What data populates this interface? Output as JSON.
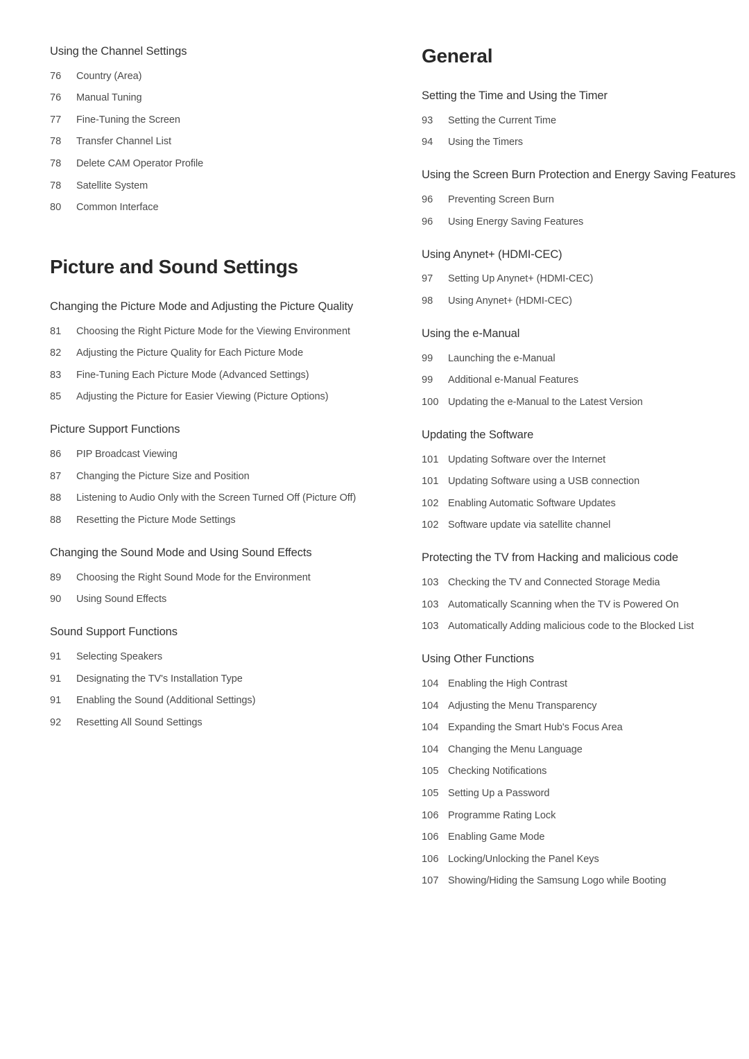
{
  "document": {
    "type": "table-of-contents",
    "columns": [
      {
        "id": "left",
        "blocks": [
          {
            "chapter_title": null,
            "sections": [
              {
                "heading": "Using the Channel Settings",
                "entries": [
                  {
                    "page": "76",
                    "title": "Country (Area)"
                  },
                  {
                    "page": "76",
                    "title": "Manual Tuning"
                  },
                  {
                    "page": "77",
                    "title": "Fine-Tuning the Screen"
                  },
                  {
                    "page": "78",
                    "title": "Transfer Channel List"
                  },
                  {
                    "page": "78",
                    "title": "Delete CAM Operator Profile"
                  },
                  {
                    "page": "78",
                    "title": "Satellite System"
                  },
                  {
                    "page": "80",
                    "title": "Common Interface"
                  }
                ]
              }
            ]
          },
          {
            "chapter_title": "Picture and Sound Settings",
            "sections": [
              {
                "heading": "Changing the Picture Mode and Adjusting the Picture Quality",
                "entries": [
                  {
                    "page": "81",
                    "title": "Choosing the Right Picture Mode for the Viewing Environment"
                  },
                  {
                    "page": "82",
                    "title": "Adjusting the Picture Quality for Each Picture Mode"
                  },
                  {
                    "page": "83",
                    "title": "Fine-Tuning Each Picture Mode (Advanced Settings)"
                  },
                  {
                    "page": "85",
                    "title": "Adjusting the Picture for Easier Viewing (Picture Options)"
                  }
                ]
              },
              {
                "heading": "Picture Support Functions",
                "entries": [
                  {
                    "page": "86",
                    "title": "PIP Broadcast Viewing"
                  },
                  {
                    "page": "87",
                    "title": "Changing the Picture Size and Position"
                  },
                  {
                    "page": "88",
                    "title": "Listening to Audio Only with the Screen Turned Off (Picture Off)"
                  },
                  {
                    "page": "88",
                    "title": "Resetting the Picture Mode Settings"
                  }
                ]
              },
              {
                "heading": "Changing the Sound Mode and Using Sound Effects",
                "entries": [
                  {
                    "page": "89",
                    "title": "Choosing the Right Sound Mode for the Environment"
                  },
                  {
                    "page": "90",
                    "title": "Using Sound Effects"
                  }
                ]
              },
              {
                "heading": "Sound Support Functions",
                "entries": [
                  {
                    "page": "91",
                    "title": "Selecting Speakers"
                  },
                  {
                    "page": "91",
                    "title": "Designating the TV's Installation Type"
                  },
                  {
                    "page": "91",
                    "title": "Enabling the Sound (Additional Settings)"
                  },
                  {
                    "page": "92",
                    "title": "Resetting All Sound Settings"
                  }
                ]
              }
            ]
          }
        ]
      },
      {
        "id": "right",
        "blocks": [
          {
            "chapter_title": "General",
            "sections": [
              {
                "heading": "Setting the Time and Using the Timer",
                "entries": [
                  {
                    "page": "93",
                    "title": "Setting the Current Time"
                  },
                  {
                    "page": "94",
                    "title": "Using the Timers"
                  }
                ]
              },
              {
                "heading": "Using the Screen Burn Protection and Energy Saving Features",
                "entries": [
                  {
                    "page": "96",
                    "title": "Preventing Screen Burn"
                  },
                  {
                    "page": "96",
                    "title": "Using Energy Saving Features"
                  }
                ]
              },
              {
                "heading": "Using Anynet+ (HDMI-CEC)",
                "entries": [
                  {
                    "page": "97",
                    "title": "Setting Up Anynet+ (HDMI-CEC)"
                  },
                  {
                    "page": "98",
                    "title": "Using Anynet+ (HDMI-CEC)"
                  }
                ]
              },
              {
                "heading": "Using the e-Manual",
                "entries": [
                  {
                    "page": "99",
                    "title": "Launching the e-Manual"
                  },
                  {
                    "page": "99",
                    "title": "Additional e-Manual Features"
                  },
                  {
                    "page": "100",
                    "title": "Updating the e-Manual to the Latest Version"
                  }
                ]
              },
              {
                "heading": "Updating the Software",
                "entries": [
                  {
                    "page": "101",
                    "title": "Updating Software over the Internet"
                  },
                  {
                    "page": "101",
                    "title": "Updating Software using a USB connection"
                  },
                  {
                    "page": "102",
                    "title": "Enabling Automatic Software Updates"
                  },
                  {
                    "page": "102",
                    "title": "Software update via satellite channel"
                  }
                ]
              },
              {
                "heading": "Protecting the TV from Hacking and malicious code",
                "entries": [
                  {
                    "page": "103",
                    "title": "Checking the TV and Connected Storage Media"
                  },
                  {
                    "page": "103",
                    "title": "Automatically Scanning when the TV is Powered On"
                  },
                  {
                    "page": "103",
                    "title": "Automatically Adding malicious code to the Blocked List"
                  }
                ]
              },
              {
                "heading": "Using Other Functions",
                "entries": [
                  {
                    "page": "104",
                    "title": "Enabling the High Contrast"
                  },
                  {
                    "page": "104",
                    "title": "Adjusting the Menu Transparency"
                  },
                  {
                    "page": "104",
                    "title": "Expanding the Smart Hub's Focus Area"
                  },
                  {
                    "page": "104",
                    "title": "Changing the Menu Language"
                  },
                  {
                    "page": "105",
                    "title": "Checking Notifications"
                  },
                  {
                    "page": "105",
                    "title": "Setting Up a Password"
                  },
                  {
                    "page": "106",
                    "title": "Programme Rating Lock"
                  },
                  {
                    "page": "106",
                    "title": "Enabling Game Mode"
                  },
                  {
                    "page": "106",
                    "title": "Locking/Unlocking the Panel Keys"
                  },
                  {
                    "page": "107",
                    "title": "Showing/Hiding the Samsung Logo while Booting"
                  }
                ]
              }
            ]
          }
        ]
      }
    ]
  },
  "colors": {
    "page_background": "#ffffff",
    "chapter_title": "#282828",
    "section_heading": "#333333",
    "entry_text": "#4a4a4a"
  }
}
